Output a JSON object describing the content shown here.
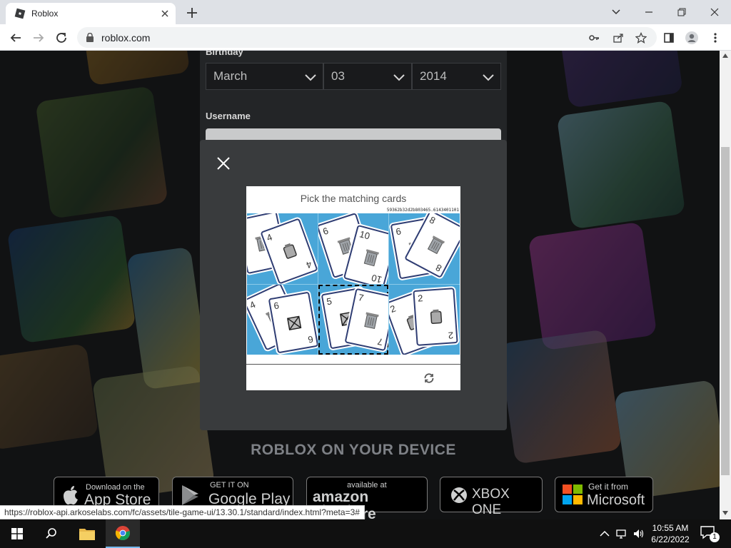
{
  "browser": {
    "tab_title": "Roblox",
    "url": "roblox.com",
    "status_url": "https://roblox-api.arkoselabs.com/fc/assets/tile-game-ui/13.30.1/standard/index.html?meta=3#"
  },
  "signup": {
    "birthday_label": "Birthday",
    "month": "March",
    "day": "03",
    "year": "2014",
    "username_label": "Username"
  },
  "captcha": {
    "title": "Pick the matching cards",
    "session_id": "59362b32d2b803465.6143401101",
    "cells": [
      {
        "cards": [
          "4",
          "4"
        ],
        "symbols": [
          "trash",
          "rect"
        ]
      },
      {
        "cards": [
          "6",
          "10"
        ],
        "symbols": [
          "trash",
          "trash"
        ]
      },
      {
        "cards": [
          "6",
          "8"
        ],
        "symbols": [
          "trash",
          "trash"
        ]
      },
      {
        "cards": [
          "4",
          "6"
        ],
        "symbols": [
          "trash",
          "x-box"
        ]
      },
      {
        "cards": [
          "5",
          "7"
        ],
        "symbols": [
          "x-box",
          "trash"
        ]
      },
      {
        "cards": [
          "2",
          "2"
        ],
        "symbols": [
          "rect",
          "rect"
        ]
      }
    ],
    "selected_index": 4
  },
  "device": {
    "heading": "ROBLOX ON YOUR DEVICE",
    "stores": [
      {
        "small": "Download on the",
        "big": "App Store",
        "icon": "apple-icon"
      },
      {
        "small": "GET IT ON",
        "big": "Google Play",
        "icon": "google-play-icon"
      },
      {
        "small": "available at",
        "big": "amazon appstore",
        "icon": "amazon-icon"
      },
      {
        "small": "",
        "big": "XBOX ONE",
        "icon": "xbox-icon"
      },
      {
        "small": "Get it from",
        "big": "Microsoft",
        "icon": "microsoft-icon"
      }
    ]
  },
  "taskbar": {
    "time": "10:55 AM",
    "date": "6/22/2022",
    "notification_count": "1"
  },
  "colors": {
    "accent": "#76b9ed",
    "captcha_bg": "#49a6d8",
    "modal_bg": "#393b3d"
  }
}
